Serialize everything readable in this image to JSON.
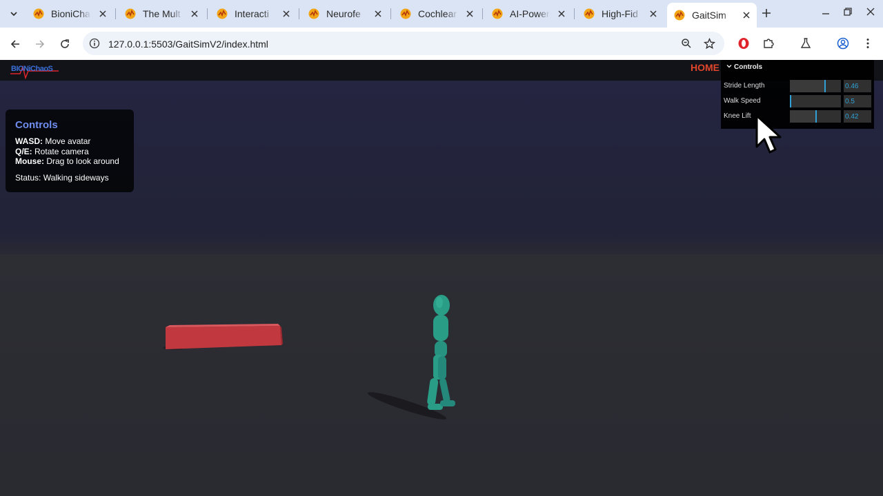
{
  "browser": {
    "tabs": [
      {
        "title": "BioniCha",
        "active": false
      },
      {
        "title": "The Mult",
        "active": false
      },
      {
        "title": "Interacti",
        "active": false
      },
      {
        "title": "Neurofe",
        "active": false
      },
      {
        "title": "Cochlear",
        "active": false
      },
      {
        "title": "AI-Power",
        "active": false
      },
      {
        "title": "High-Fid",
        "active": false
      },
      {
        "title": "GaitSim",
        "active": true
      }
    ],
    "url": "127.0.0.1:5503/GaitSimV2/index.html",
    "icons": {
      "tab_menu": "chevron-down-icon",
      "new_tab": "plus-icon",
      "back": "back-arrow-icon",
      "forward": "forward-arrow-icon",
      "reload": "reload-icon",
      "site_info": "info-icon",
      "zoom": "zoom-icon",
      "bookmark": "star-icon",
      "extension_opera": "opera-icon",
      "extensions": "puzzle-icon",
      "labs": "flask-icon",
      "profile": "profile-icon",
      "menu": "kebab-menu-icon"
    }
  },
  "site": {
    "logo": "BIONiChaoS",
    "home_link": "HOME"
  },
  "help_panel": {
    "title": "Controls",
    "lines": [
      {
        "key": "WASD:",
        "desc": "Move avatar"
      },
      {
        "key": "Q/E:",
        "desc": "Rotate camera"
      },
      {
        "key": "Mouse:",
        "desc": "Drag to look around"
      }
    ],
    "status": "Status: Walking sideways"
  },
  "gui": {
    "title": "Controls",
    "params": [
      {
        "label": "Stride Length",
        "value": "0.46",
        "fraction": 0.7
      },
      {
        "label": "Walk Speed",
        "value": "0.5",
        "fraction": 0.0
      },
      {
        "label": "Knee Lift",
        "value": "0.42",
        "fraction": 0.51
      }
    ]
  },
  "colors": {
    "accent_blue": "#2fa1d6",
    "home_red": "#e0462b",
    "avatar_teal": "#2a9d87",
    "obstacle_red": "#c1393f",
    "panel_title": "#6f8df0"
  }
}
